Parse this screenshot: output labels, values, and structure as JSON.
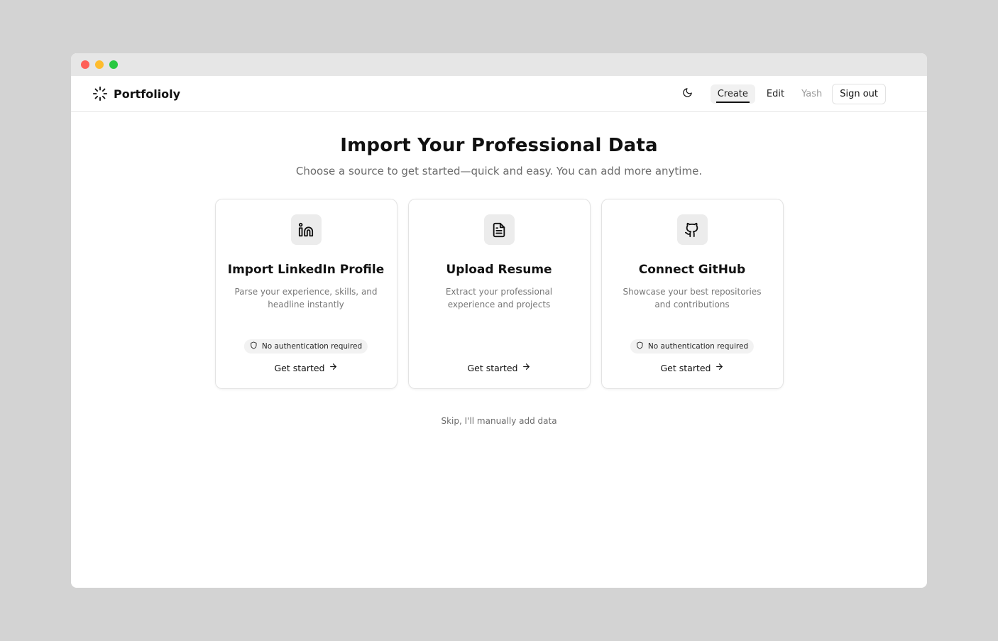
{
  "window": {
    "controls": [
      "close",
      "minimize",
      "maximize"
    ]
  },
  "navbar": {
    "brand": "Portfolioly",
    "brand_icon": "sparkle-burst-icon",
    "theme_icon": "moon-icon",
    "links": [
      {
        "label": "Create",
        "active": true
      },
      {
        "label": "Edit",
        "active": false
      }
    ],
    "user": "Yash",
    "signout_label": "Sign out"
  },
  "main": {
    "title": "Import Your Professional Data",
    "subtitle": "Choose a source to get started—quick and easy. You can add more anytime.",
    "cards": [
      {
        "icon": "linkedin-icon",
        "title": "Import LinkedIn Profile",
        "description": "Parse your experience, skills, and headline instantly",
        "badge": "No authentication required",
        "cta": "Get started"
      },
      {
        "icon": "document-icon",
        "title": "Upload Resume",
        "description": "Extract your professional experience and projects",
        "badge": "",
        "cta": "Get started"
      },
      {
        "icon": "github-icon",
        "title": "Connect GitHub",
        "description": "Showcase your best repositories and contributions",
        "badge": "No authentication required",
        "cta": "Get started"
      }
    ],
    "skip_label": "Skip, I'll manually add data"
  },
  "colors": {
    "background": "#d3d3d3",
    "titlebar": "#e6e6e6",
    "close": "#fe5f57",
    "minimize": "#febc2e",
    "maximize": "#28c840",
    "muted_text": "#6b6b6b",
    "icon_tile": "#ececec"
  }
}
